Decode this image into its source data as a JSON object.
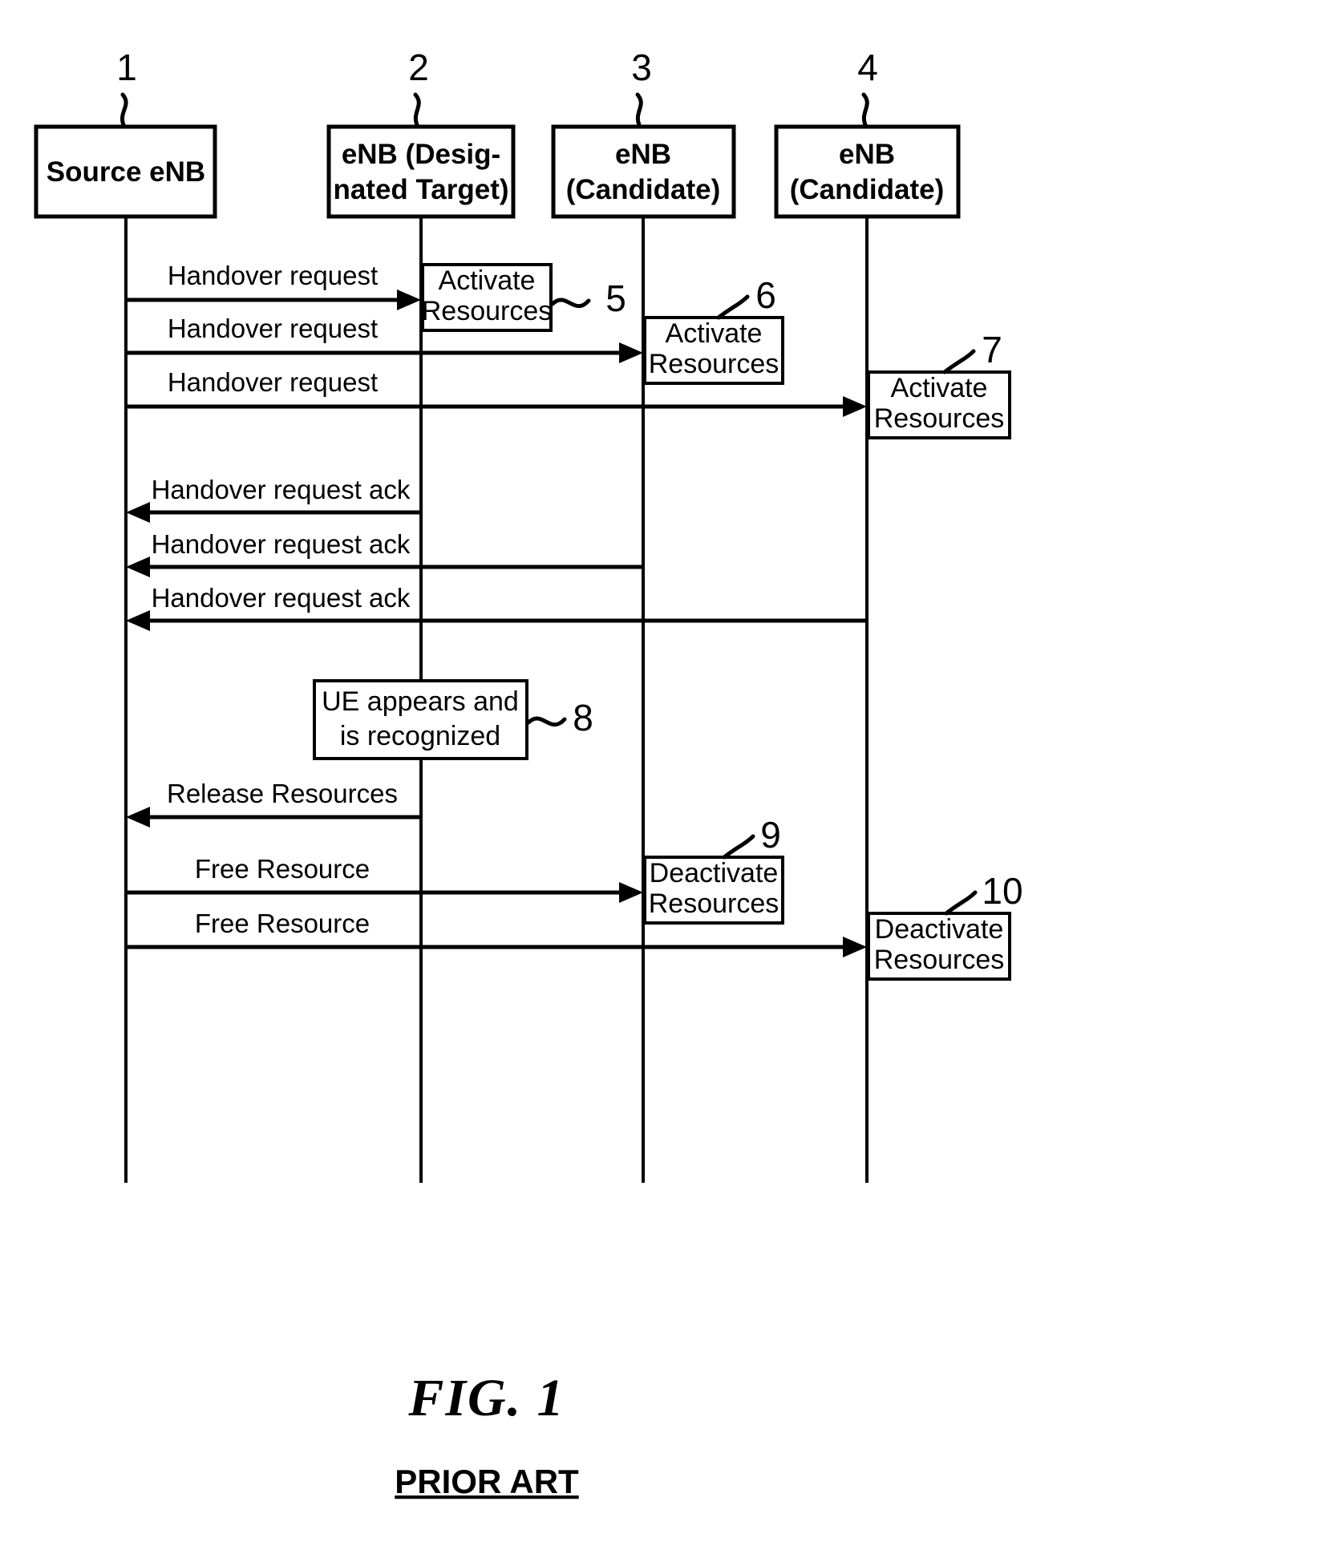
{
  "figure": {
    "title": "FIG.   1",
    "subtitle": "PRIOR ART"
  },
  "nodes": [
    {
      "ref": "1",
      "line1": "Source eNB",
      "line2": ""
    },
    {
      "ref": "2",
      "line1": "eNB (Desig-",
      "line2": "nated Target)"
    },
    {
      "ref": "3",
      "line1": "eNB",
      "line2": "(Candidate)"
    },
    {
      "ref": "4",
      "line1": "eNB",
      "line2": "(Candidate)"
    }
  ],
  "messages": [
    {
      "label": "Handover request",
      "direction": "right"
    },
    {
      "label": "Handover request",
      "direction": "right"
    },
    {
      "label": "Handover request",
      "direction": "right"
    },
    {
      "label": "Handover request ack",
      "direction": "left"
    },
    {
      "label": "Handover request ack",
      "direction": "left"
    },
    {
      "label": "Handover request ack",
      "direction": "left"
    },
    {
      "label": "Release Resources",
      "direction": "left"
    },
    {
      "label": "Free Resource",
      "direction": "right"
    },
    {
      "label": "Free Resource",
      "direction": "right"
    }
  ],
  "action_boxes": [
    {
      "ref": "5",
      "line1": "Activate",
      "line2": "Resources"
    },
    {
      "ref": "6",
      "line1": "Activate",
      "line2": "Resources"
    },
    {
      "ref": "7",
      "line1": "Activate",
      "line2": "Resources"
    },
    {
      "ref": "8",
      "line1": "UE appears and",
      "line2": "is recognized"
    },
    {
      "ref": "9",
      "line1": "Deactivate",
      "line2": "Resources"
    },
    {
      "ref": "10",
      "line1": "Deactivate",
      "line2": "Resources"
    }
  ],
  "colors": {
    "ink": "#000000",
    "paper": "#ffffff"
  }
}
